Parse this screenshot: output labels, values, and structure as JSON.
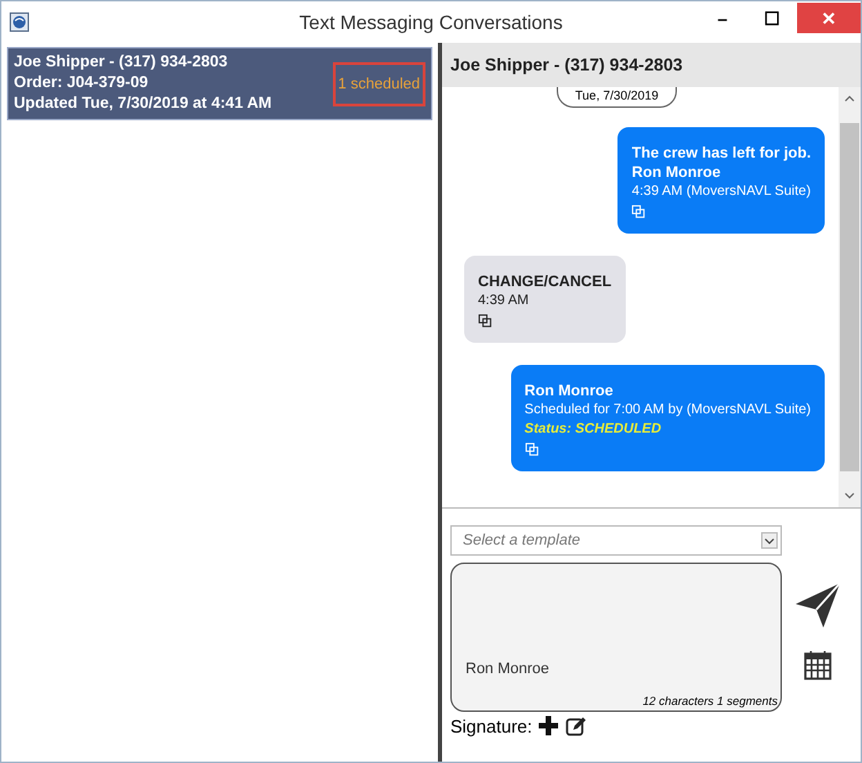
{
  "window": {
    "title": "Text Messaging Conversations",
    "controls": [
      "–",
      "☐",
      "✕"
    ]
  },
  "conversations": [
    {
      "name": "Joe Shipper -  (317) 934-2803",
      "order": "Order: J04-379-09",
      "updated": "Updated Tue, 7/30/2019 at 4:41 AM",
      "badge": "1 scheduled",
      "selected": true
    }
  ],
  "header": {
    "title": "Joe Shipper - (317) 934-2803"
  },
  "date_pill": "Tue, 7/30/2019",
  "messages": [
    {
      "kind": "outgoing",
      "lines": [
        {
          "kind": "bold",
          "text": "The crew has left for job."
        },
        {
          "kind": "bold",
          "text": "Ron Monroe"
        },
        {
          "kind": "meta",
          "text": "4:39 AM (MoversNAVL Suite)"
        }
      ]
    },
    {
      "kind": "incoming",
      "lines": [
        {
          "kind": "bold",
          "text": "CHANGE/CANCEL"
        },
        {
          "kind": "meta",
          "text": "4:39 AM"
        }
      ]
    },
    {
      "kind": "outgoing",
      "lines": [
        {
          "kind": "bold",
          "text": "Ron Monroe"
        },
        {
          "kind": "meta",
          "text": "Scheduled for 7:00 AM by (MoversNAVL Suite)"
        },
        {
          "kind": "status",
          "text": "Status: SCHEDULED"
        }
      ]
    }
  ],
  "template": {
    "placeholder": "Select a template"
  },
  "compose": {
    "value": "Ron Monroe",
    "counter": "12 characters 1 segments"
  },
  "signature": {
    "label": "Signature:"
  }
}
